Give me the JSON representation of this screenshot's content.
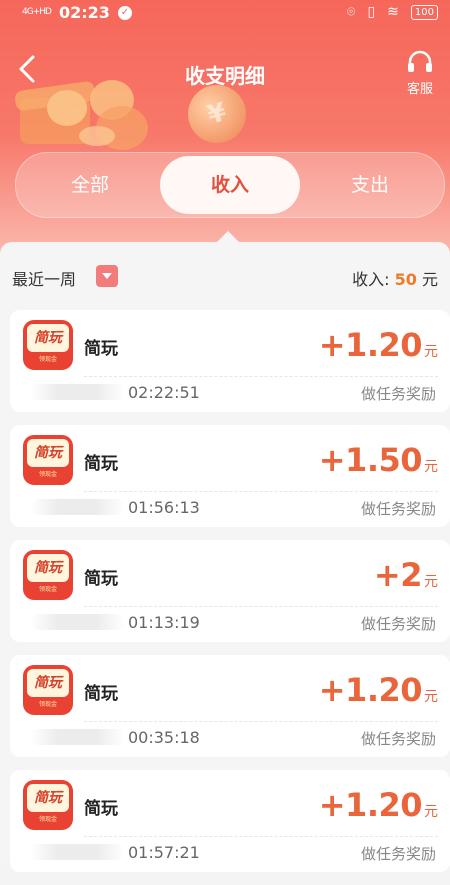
{
  "status_bar": {
    "network": "4G+HD",
    "time": "02:23",
    "battery": "100"
  },
  "header": {
    "title": "收支明细",
    "service_label": "客服"
  },
  "tabs": [
    {
      "label": "全部",
      "selected": false
    },
    {
      "label": "收入",
      "selected": true
    },
    {
      "label": "支出",
      "selected": false
    }
  ],
  "filter": {
    "period": "最近一周",
    "total_label": "收入:",
    "total_value": "50",
    "total_unit": "元"
  },
  "records": [
    {
      "app_name": "简玩",
      "icon_text": "简玩",
      "icon_sub": "领现金",
      "amount": "+1.20",
      "unit": "元",
      "time": "02:22:51",
      "desc": "做任务奖励"
    },
    {
      "app_name": "简玩",
      "icon_text": "简玩",
      "icon_sub": "领现金",
      "amount": "+1.50",
      "unit": "元",
      "time": "01:56:13",
      "desc": "做任务奖励"
    },
    {
      "app_name": "简玩",
      "icon_text": "简玩",
      "icon_sub": "领现金",
      "amount": "+2",
      "unit": "元",
      "time": "01:13:19",
      "desc": "做任务奖励"
    },
    {
      "app_name": "简玩",
      "icon_text": "简玩",
      "icon_sub": "领现金",
      "amount": "+1.20",
      "unit": "元",
      "time": "00:35:18",
      "desc": "做任务奖励"
    },
    {
      "app_name": "简玩",
      "icon_text": "简玩",
      "icon_sub": "领现金",
      "amount": "+1.20",
      "unit": "元",
      "time": "01:57:21",
      "desc": "做任务奖励"
    }
  ],
  "colors": {
    "header": "#f6675a",
    "accent_amount": "#e9663c",
    "total_value": "#f07a2b"
  }
}
